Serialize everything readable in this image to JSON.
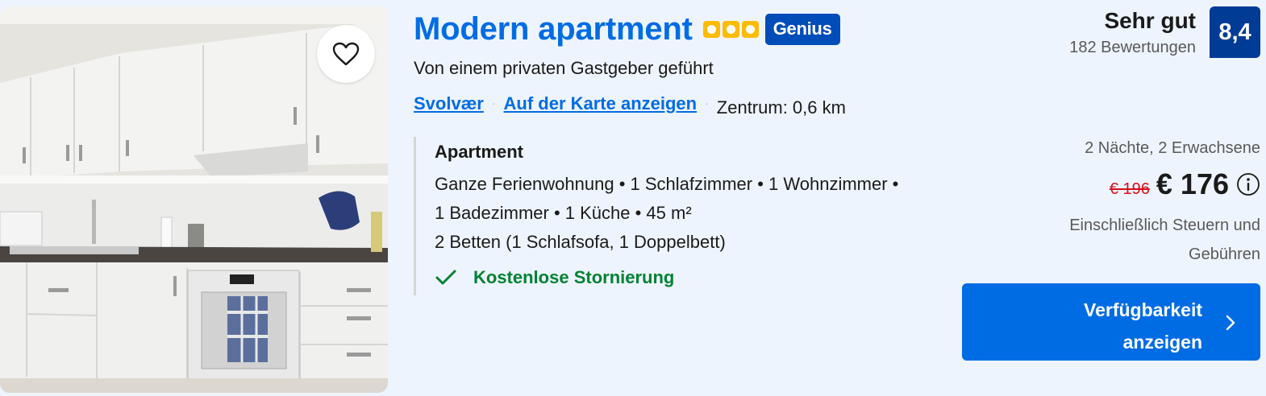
{
  "listing": {
    "title": "Modern apartment",
    "stars": 3,
    "genius_badge": "Genius",
    "host": "Von einem privaten Gastgeber geführt",
    "location": {
      "city": "Svolvær",
      "map_link": "Auf der Karte anzeigen",
      "distance": "Zentrum: 0,6 km"
    },
    "unit": {
      "name": "Apartment",
      "line1": "Ganze Ferienwohnung • 1 Schlafzimmer • 1 Wohnzimmer •",
      "line2": "1 Badezimmer • 1 Küche • 45 m²",
      "beds": "2 Betten (1 Schlafsofa, 1 Doppelbett)",
      "free_cancellation": "Kostenlose Stornierung"
    }
  },
  "rating": {
    "label": "Sehr gut",
    "reviews": "182 Bewertungen",
    "score": "8,4"
  },
  "pricing": {
    "stay": "2 Nächte, 2 Erwachsene",
    "old_price": "€ 196",
    "price": "€ 176",
    "tax_note": "Einschließlich Steuern und Gebühren"
  },
  "cta": {
    "label": "Verfügbarkeit anzeigen"
  },
  "colors": {
    "brand_blue": "#006ce4",
    "dark_blue": "#003b95",
    "genius_blue": "#004cb8",
    "star_yellow": "#febb02",
    "green": "#008234",
    "red": "#d4111e"
  },
  "icons": [
    "heart-icon",
    "star-icon",
    "checkmark-icon",
    "info-icon",
    "chevron-right-icon"
  ]
}
